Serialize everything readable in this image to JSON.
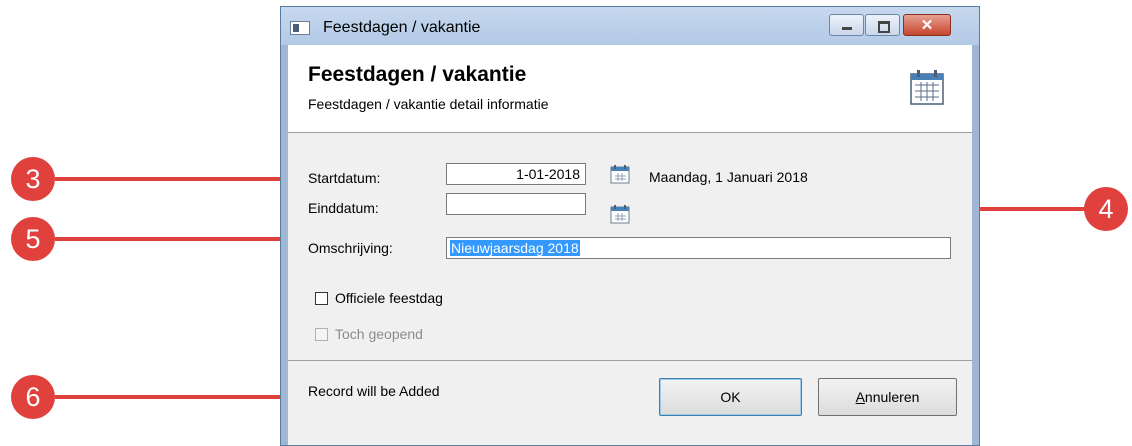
{
  "window": {
    "title": "Feestdagen / vakantie"
  },
  "header": {
    "title": "Feestdagen / vakantie",
    "subtitle": "Feestdagen / vakantie detail informatie"
  },
  "form": {
    "start_label": "Startdatum:",
    "start_value": "1-01-2018",
    "start_text": "Maandag, 1 Januari 2018",
    "end_label": "Einddatum:",
    "end_value": "",
    "desc_label": "Omschrijving:",
    "desc_value": "Nieuwjaarsdag 2018",
    "official_label": "Officiele feestdag",
    "official_checked": false,
    "open_label": "Toch geopend",
    "open_checked": false,
    "open_enabled": false
  },
  "footer": {
    "status": "Record will be Added",
    "ok_label": "OK",
    "cancel_label": "Annuleren"
  },
  "callouts": [
    "3",
    "4",
    "5",
    "6"
  ],
  "colors": {
    "callout": "#e0413c",
    "arrow": "#e0413c",
    "selection": "#3399ff"
  }
}
